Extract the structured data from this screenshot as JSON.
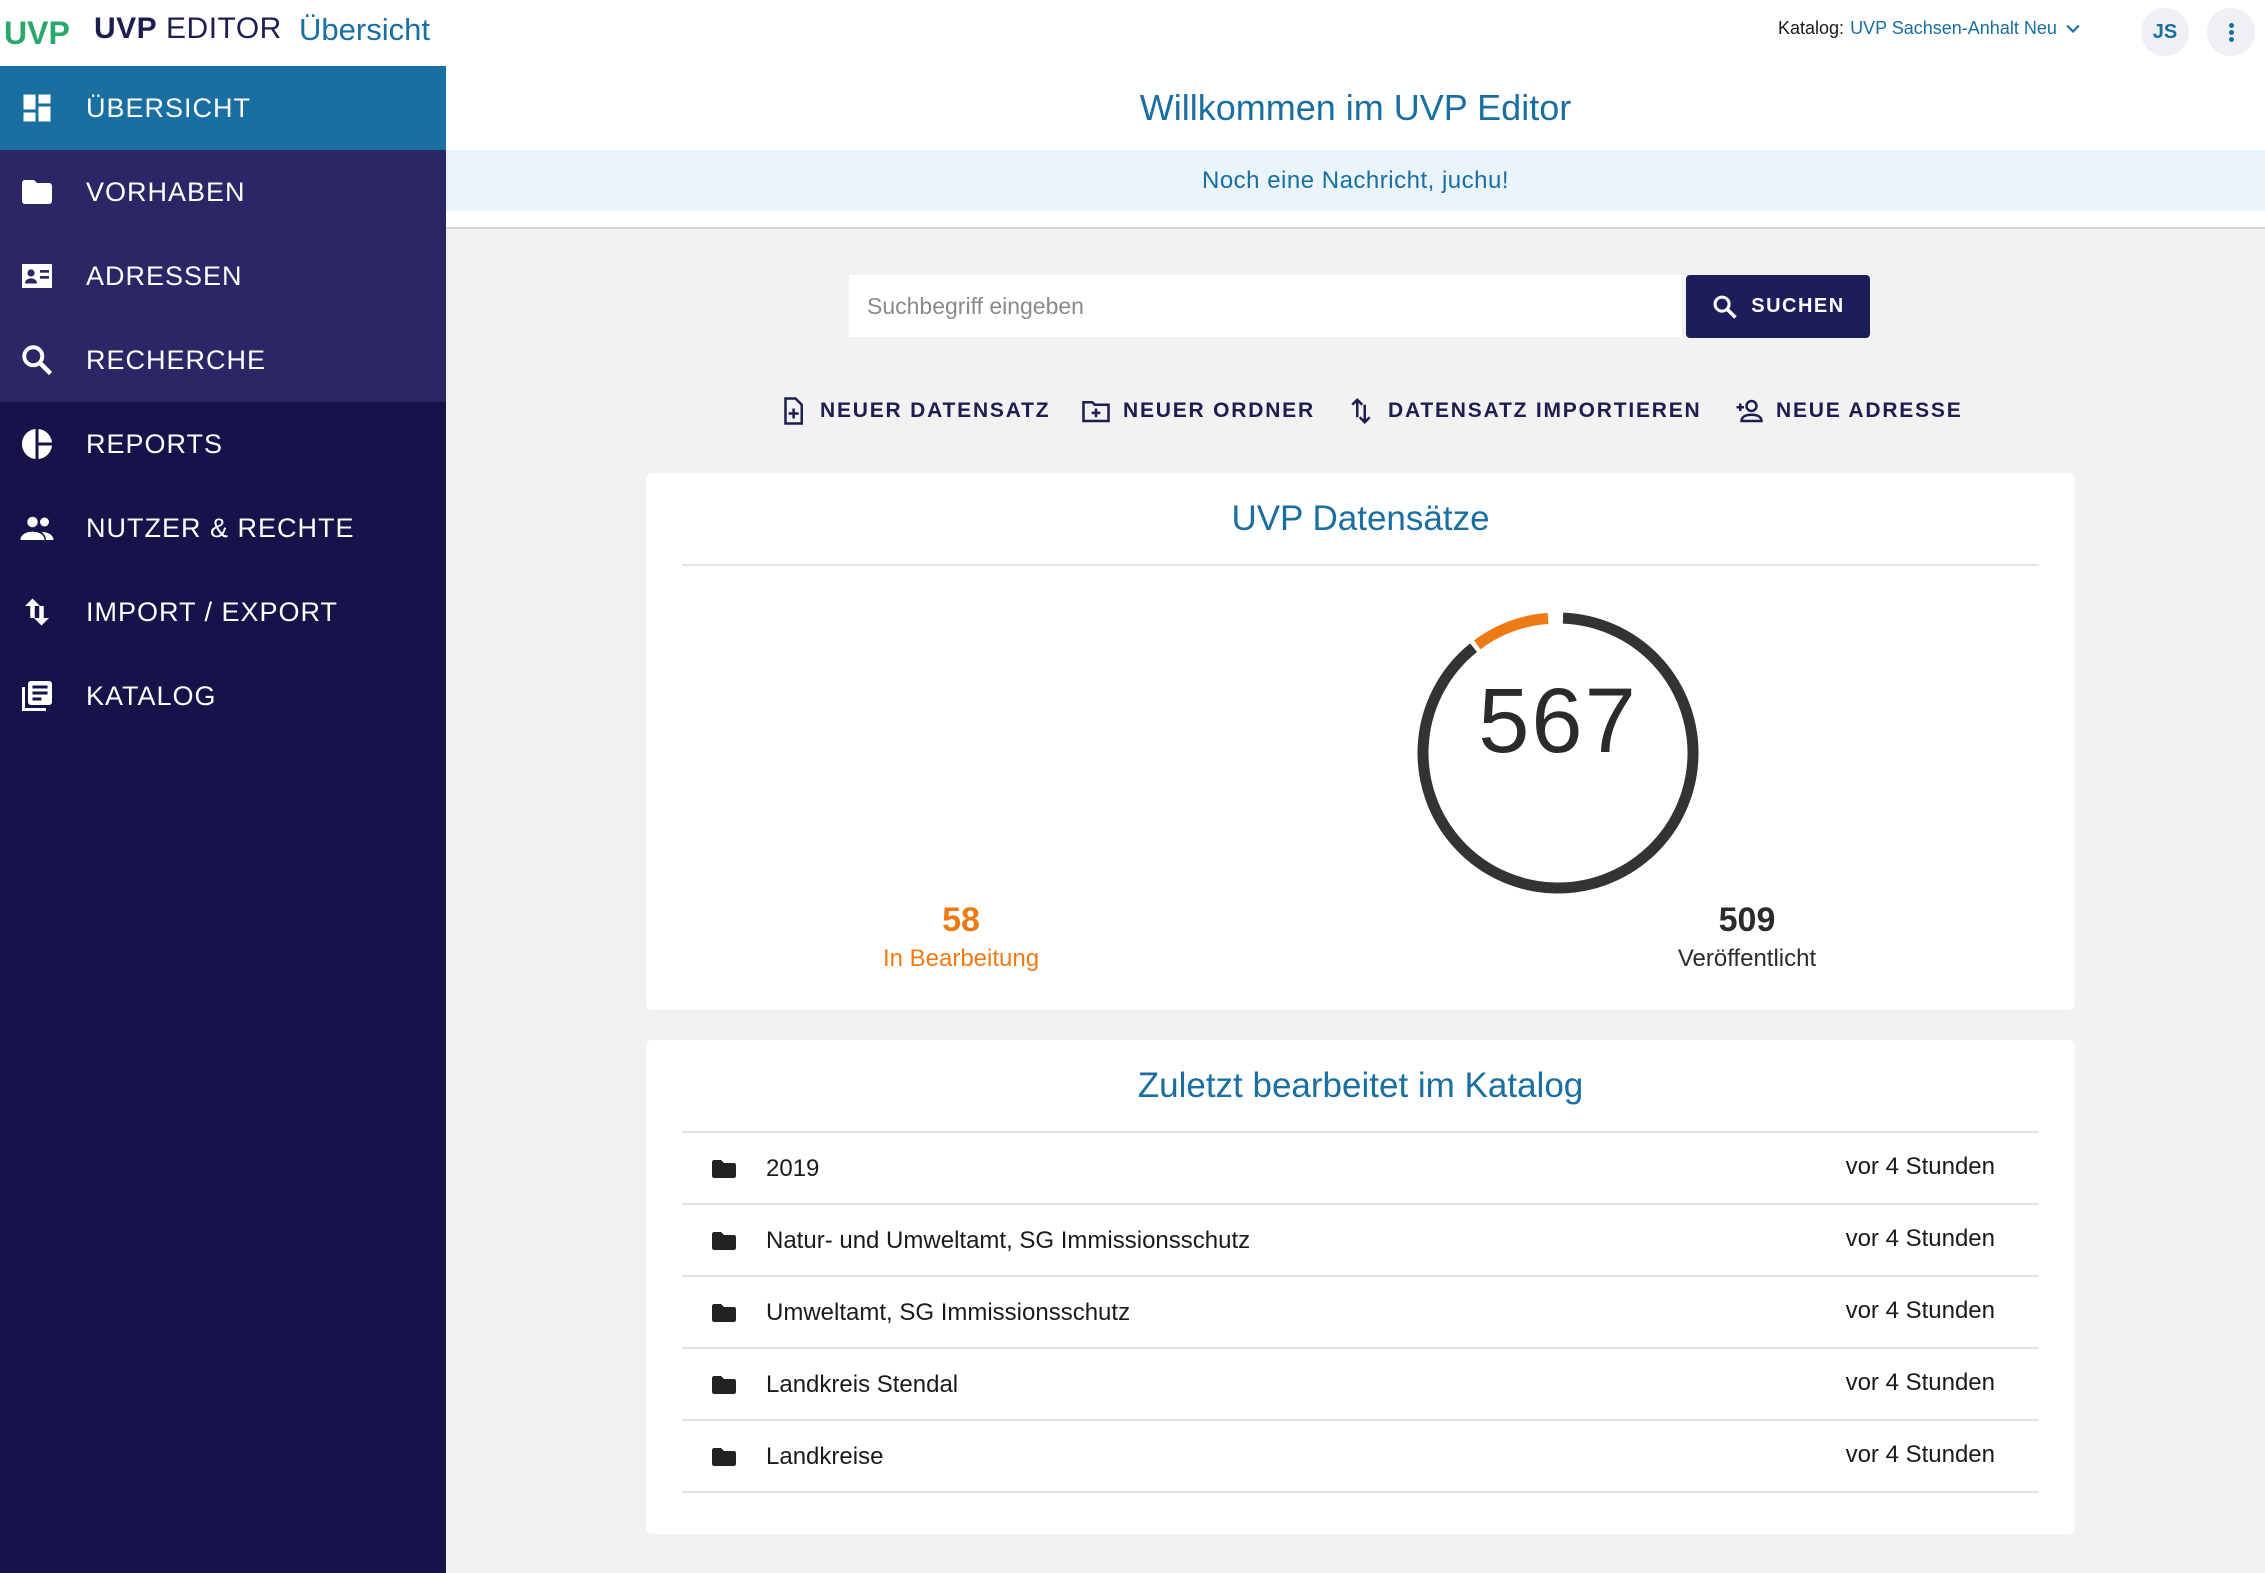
{
  "header": {
    "logo_text": "UVP",
    "app_name_bold": "UVP",
    "app_name_rest": "EDITOR",
    "page_title": "Übersicht",
    "catalog_label": "Katalog:",
    "catalog_value": "UVP Sachsen-Anhalt Neu",
    "user_initials": "JS"
  },
  "sidebar": {
    "items": [
      {
        "label": "ÜBERSICHT",
        "icon": "dashboard-icon"
      },
      {
        "label": "VORHABEN",
        "icon": "folder-icon"
      },
      {
        "label": "ADRESSEN",
        "icon": "contact-card-icon"
      },
      {
        "label": "RECHERCHE",
        "icon": "search-icon"
      },
      {
        "label": "REPORTS",
        "icon": "pie-chart-icon"
      },
      {
        "label": "NUTZER & RECHTE",
        "icon": "people-icon"
      },
      {
        "label": "IMPORT / EXPORT",
        "icon": "import-export-icon"
      },
      {
        "label": "KATALOG",
        "icon": "library-icon"
      }
    ]
  },
  "main": {
    "welcome": "Willkommen im UVP Editor",
    "notice": "Noch eine Nachricht, juchu!",
    "search": {
      "placeholder": "Suchbegriff eingeben",
      "value": "",
      "button_label": "SUCHEN"
    },
    "actions": [
      {
        "label": "NEUER DATENSATZ",
        "icon": "new-document-icon"
      },
      {
        "label": "NEUER ORDNER",
        "icon": "new-folder-icon"
      },
      {
        "label": "DATENSATZ IMPORTIEREN",
        "icon": "import-icon"
      },
      {
        "label": "NEUE ADRESSE",
        "icon": "add-person-icon"
      }
    ],
    "stats": {
      "title": "UVP Datensätze",
      "total": "567",
      "in_progress_count": "58",
      "in_progress_label": "In Bearbeitung",
      "published_count": "509",
      "published_label": "Veröffentlicht",
      "in_progress_fraction": 0.102,
      "colors": {
        "in_progress": "#ee7a14",
        "published": "#333333"
      }
    },
    "recent": {
      "title": "Zuletzt bearbeitet im Katalog",
      "items": [
        {
          "name": "2019",
          "time": "vor 4 Stunden"
        },
        {
          "name": "Natur- und Umweltamt, SG Immissionsschutz",
          "time": "vor 4 Stunden"
        },
        {
          "name": "Umweltamt, SG Immissionsschutz",
          "time": "vor 4 Stunden"
        },
        {
          "name": "Landkreis Stendal",
          "time": "vor 4 Stunden"
        },
        {
          "name": "Landkreise",
          "time": "vor 4 Stunden"
        }
      ]
    }
  },
  "colors": {
    "brand_blue": "#196ea2",
    "sidebar_bg": "#15134a",
    "accent_orange": "#ee7a14"
  }
}
